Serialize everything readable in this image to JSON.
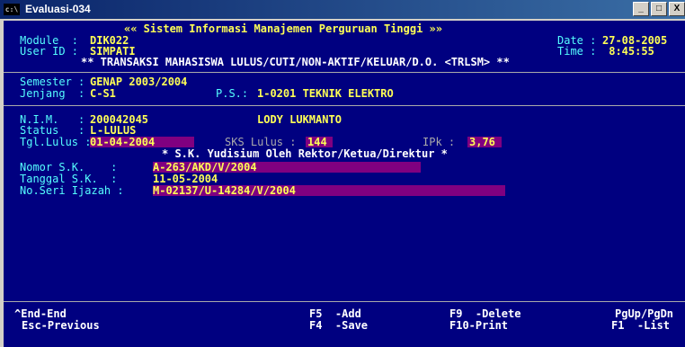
{
  "window": {
    "title": "Evaluasi-034",
    "icon": "console-icon",
    "icon_glyph": "c:\\",
    "min": "_",
    "max": "□",
    "close": "X"
  },
  "header": {
    "system_title": "«« Sistem Informasi Manajemen Perguruan Tinggi »»",
    "module_label": "Module  :",
    "module_value": "DIK022",
    "user_label": "User ID :",
    "user_value": "SIMPATI",
    "date_label": "Date :",
    "date_value": "27-08-2005",
    "time_label": "Time :",
    "time_value": " 8:45:55",
    "transaction_title": "** TRANSAKSI MAHASISWA LULUS/CUTI/NON-AKTIF/KELUAR/D.O. <TRLSM> **"
  },
  "semester": {
    "semester_label": "Semester :",
    "semester_value": "GENAP 2003/2004",
    "jenjang_label": "Jenjang  :",
    "jenjang_value": "C-S1",
    "ps_label": "P.S.:",
    "ps_value": "1-0201 TEKNIK ELEKTRO"
  },
  "student": {
    "nim_label": "N.I.M.   :",
    "nim_value": "200042045",
    "name_value": "LODY LUKMANTO",
    "status_label": "Status   :",
    "status_code": "L",
    "status_text": "-LULUS",
    "tgl_label": "Tgl.Lulus :",
    "tgl_value": "01-04-2004",
    "sks_label": "SKS Lulus :",
    "sks_value": "144",
    "ipk_label": "IPk :",
    "ipk_value": "3,76"
  },
  "sk": {
    "section_title": "* S.K. Yudisium Oleh Rektor/Ketua/Direktur *",
    "nomor_label": "Nomor S.K.    :",
    "nomor_value": "A-263/AKD/V/2004",
    "tanggal_label": "Tanggal S.K.  :",
    "tanggal_value": "11-05-2004",
    "noseri_label": "No.Seri Ijazah :",
    "noseri_value": "M-02137/U-14284/V/2004"
  },
  "footer": {
    "end_key": "^End-End",
    "esc_key": "Esc-Previous",
    "f5": "F5  -Add",
    "f4": "F4  -Save",
    "f9": "F9  -Delete",
    "f10": "F10-Print",
    "pg": "PgUp/PgDn",
    "f1": "F1  -List"
  }
}
